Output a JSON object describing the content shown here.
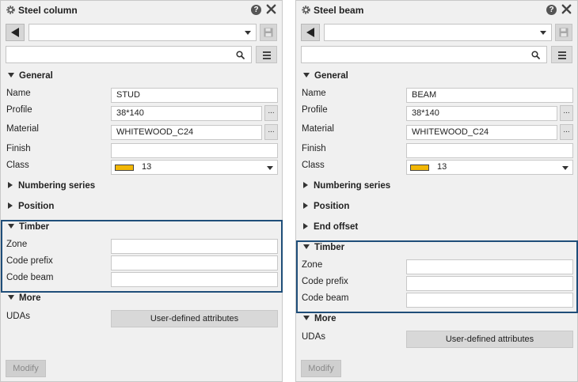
{
  "left": {
    "title": "Steel column",
    "help": "?",
    "preset": "",
    "search": "",
    "sections": {
      "general": "General",
      "numbering": "Numbering series",
      "position": "Position",
      "timber": "Timber",
      "more": "More"
    },
    "labels": {
      "name": "Name",
      "profile": "Profile",
      "material": "Material",
      "finish": "Finish",
      "class": "Class",
      "zone": "Zone",
      "code_prefix": "Code prefix",
      "code_beam": "Code beam",
      "udas": "UDAs"
    },
    "values": {
      "name": "STUD",
      "profile": "38*140",
      "material": "WHITEWOOD_C24",
      "finish": "",
      "class": "13",
      "zone": "",
      "code_prefix": "",
      "code_beam": ""
    },
    "dots": "...",
    "uda_button": "User-defined attributes",
    "modify_button": "Modify"
  },
  "right": {
    "title": "Steel beam",
    "help": "?",
    "preset": "",
    "search": "",
    "sections": {
      "general": "General",
      "numbering": "Numbering series",
      "position": "Position",
      "end_offset": "End offset",
      "timber": "Timber",
      "more": "More"
    },
    "labels": {
      "name": "Name",
      "profile": "Profile",
      "material": "Material",
      "finish": "Finish",
      "class": "Class",
      "zone": "Zone",
      "code_prefix": "Code prefix",
      "code_beam": "Code beam",
      "udas": "UDAs"
    },
    "values": {
      "name": "BEAM",
      "profile": "38*140",
      "material": "WHITEWOOD_C24",
      "finish": "",
      "class": "13",
      "zone": "",
      "code_prefix": "",
      "code_beam": ""
    },
    "dots": "...",
    "uda_button": "User-defined attributes",
    "modify_button": "Modify"
  },
  "colors": {
    "highlight": "#1f4e79",
    "class_swatch": "#f2b705",
    "panel_background": "#f0f0f0"
  },
  "icons": [
    "gear-icon",
    "help-icon",
    "close-icon",
    "back-arrow-icon",
    "save-icon",
    "search-icon",
    "menu-icon",
    "chevron-down-icon",
    "chevron-right-icon"
  ]
}
